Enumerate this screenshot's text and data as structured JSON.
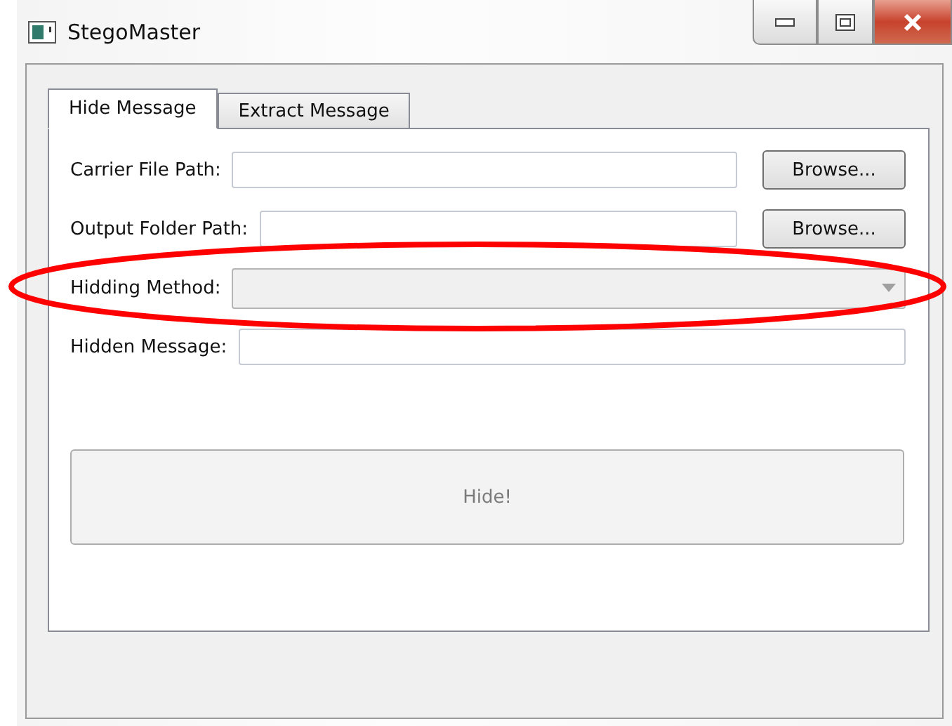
{
  "window": {
    "title": "StegoMaster"
  },
  "tabs": [
    {
      "label": "Hide Message",
      "selected": true
    },
    {
      "label": "Extract Message",
      "selected": false
    }
  ],
  "form_rows": [
    {
      "kind": "browse",
      "label": "Carrier File Path:",
      "button": "Browse..."
    },
    {
      "kind": "browse",
      "label": "Output Folder Path:",
      "button": "Browse..."
    },
    {
      "kind": "combo",
      "label": "Hidding Method:",
      "disabled": true
    },
    {
      "kind": "text",
      "label": "Hidden Message:"
    }
  ],
  "hide_button": {
    "label": "Hide!",
    "disabled": true
  }
}
